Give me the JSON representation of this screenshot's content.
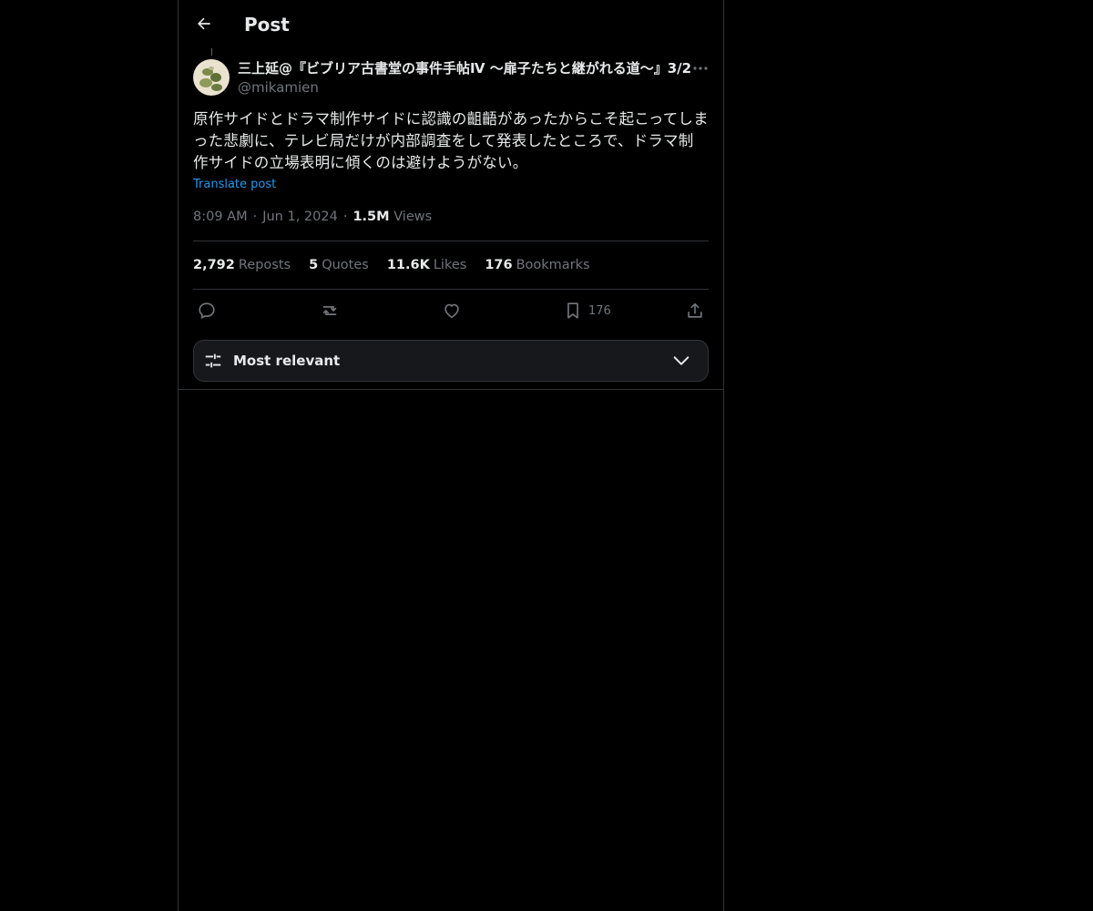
{
  "header": {
    "back_icon": "arrow-left-icon",
    "title": "Post"
  },
  "author": {
    "name": "三上延@『ビブリア古書堂の事件手帖Ⅳ 〜扉子たちと継がれる道〜』3/2",
    "handle": "@mikamien",
    "avatar_icon": "avatar-image"
  },
  "post": {
    "text": "原作サイドとドラマ制作サイドに認識の齟齬があったからこそ起こってしまった悲劇に、テレビ局だけが内部調査をして発表したところで、ドラマ制作サイドの立場表明に傾くのは避けようがない。",
    "translate_label": "Translate post",
    "time": "8:09 AM",
    "date": "Jun 1, 2024",
    "views_count": "1.5M",
    "views_label": "Views"
  },
  "stats": [
    {
      "count": "2,792",
      "label": "Reposts"
    },
    {
      "count": "5",
      "label": "Quotes"
    },
    {
      "count": "11.6K",
      "label": "Likes"
    },
    {
      "count": "176",
      "label": "Bookmarks"
    }
  ],
  "actions": {
    "reply_icon": "reply-icon",
    "repost_icon": "repost-icon",
    "like_icon": "heart-icon",
    "bookmark_icon": "bookmark-icon",
    "bookmark_count": "176",
    "share_icon": "share-icon"
  },
  "sort": {
    "icon": "sliders-icon",
    "label": "Most relevant",
    "chevron": "chevron-down-icon"
  },
  "colors": {
    "background": "#000000",
    "text": "#e7e9ea",
    "muted": "#71767b",
    "accent": "#1d9bf0",
    "border": "#2f3336"
  }
}
